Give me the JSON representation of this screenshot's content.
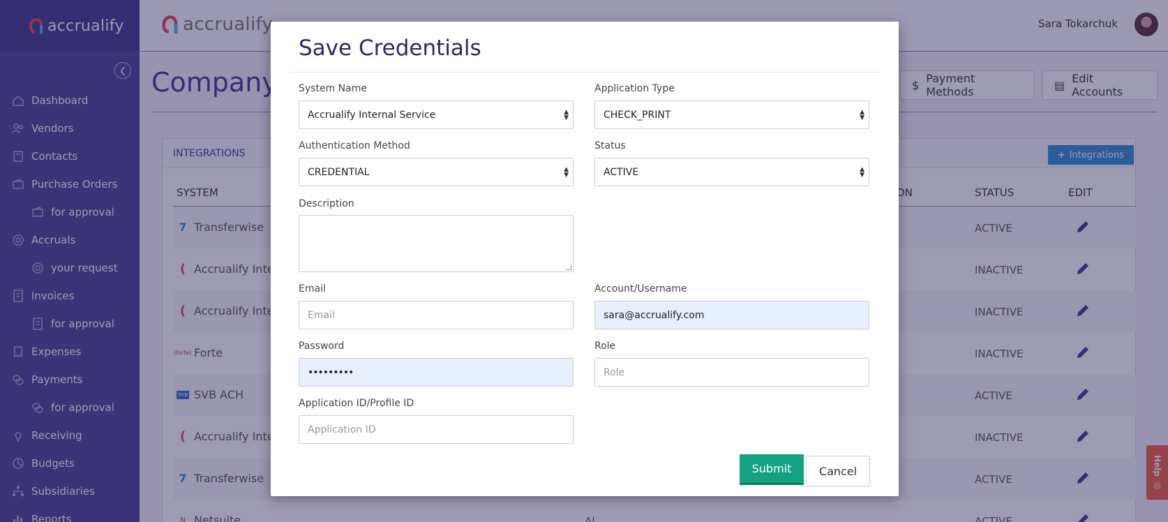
{
  "brand": {
    "name": "accrualify"
  },
  "sidebar": {
    "items": [
      {
        "label": "Dashboard",
        "icon": "home-icon",
        "sub": false
      },
      {
        "label": "Vendors",
        "icon": "users-icon",
        "sub": false
      },
      {
        "label": "Contacts",
        "icon": "contact-book-icon",
        "sub": false
      },
      {
        "label": "Purchase Orders",
        "icon": "wallet-icon",
        "sub": false
      },
      {
        "label": "for approval",
        "icon": "wallet-icon",
        "sub": true
      },
      {
        "label": "Accruals",
        "icon": "target-icon",
        "sub": false
      },
      {
        "label": "your request",
        "icon": "target-icon",
        "sub": true
      },
      {
        "label": "Invoices",
        "icon": "document-icon",
        "sub": false
      },
      {
        "label": "for approval",
        "icon": "document-icon",
        "sub": true
      },
      {
        "label": "Expenses",
        "icon": "receipt-icon",
        "sub": false
      },
      {
        "label": "Payments",
        "icon": "coins-icon",
        "sub": false
      },
      {
        "label": "for approval",
        "icon": "coins-icon",
        "sub": true
      },
      {
        "label": "Receiving",
        "icon": "pin-icon",
        "sub": false
      },
      {
        "label": "Budgets",
        "icon": "pie-icon",
        "sub": false
      },
      {
        "label": "Subsidiaries",
        "icon": "hierarchy-icon",
        "sub": false
      },
      {
        "label": "Reports",
        "icon": "bar-chart-icon",
        "sub": false
      }
    ]
  },
  "topbar": {
    "user_name": "Sara Tokarchuk"
  },
  "page": {
    "title": "Company",
    "payment_methods_label": "Payment Methods",
    "edit_accounts_label": "Edit Accounts"
  },
  "integrations": {
    "header": "INTEGRATIONS",
    "add_button": "Integrations",
    "columns": {
      "system": "SYSTEM",
      "auth_partial": "ON",
      "status": "STATUS",
      "edit": "EDIT"
    },
    "rows": [
      {
        "system": "Transferwise",
        "status": "ACTIVE",
        "icon": "transferwise-icon"
      },
      {
        "system": "Accrualify Integ",
        "status": "INACTIVE",
        "icon": "accrualify-icon"
      },
      {
        "system": "Accrualify Integ",
        "status": "INACTIVE",
        "icon": "accrualify-icon"
      },
      {
        "system": "Forte",
        "status": "INACTIVE",
        "icon": "forte-icon"
      },
      {
        "system": "SVB ACH",
        "status": "ACTIVE",
        "icon": "svb-icon"
      },
      {
        "system": "Accrualify Integ",
        "status": "INACTIVE",
        "icon": "accrualify-icon"
      },
      {
        "system": "Transferwise",
        "status": "ACTIVE",
        "icon": "transferwise-icon"
      },
      {
        "system": "Netsuite",
        "status": "ACTIVE",
        "icon": "netsuite-icon",
        "extra": "Al"
      }
    ]
  },
  "help_label": "Help",
  "modal": {
    "title": "Save Credentials",
    "system_name": {
      "label": "System Name",
      "value": "Accrualify Internal Service"
    },
    "application_type": {
      "label": "Application Type",
      "value": "CHECK_PRINT"
    },
    "auth_method": {
      "label": "Authentication Method",
      "value": "CREDENTIAL"
    },
    "status": {
      "label": "Status",
      "value": "ACTIVE"
    },
    "description": {
      "label": "Description",
      "value": ""
    },
    "email": {
      "label": "Email",
      "placeholder": "Email",
      "value": ""
    },
    "account": {
      "label": "Account/Username",
      "value": "sara@accrualify.com"
    },
    "password": {
      "label": "Password",
      "value": "•••••••••"
    },
    "role": {
      "label": "Role",
      "placeholder": "Role",
      "value": ""
    },
    "app_id": {
      "label": "Application ID/Profile ID",
      "placeholder": "Application ID",
      "value": ""
    },
    "submit_label": "Submit",
    "cancel_label": "Cancel"
  },
  "colors": {
    "sidebar_bg": "#4a4290",
    "accent_purple": "#3d3788",
    "submit_green": "#15a283",
    "integrations_blue": "#2f8bcc",
    "help_orange": "#ee5d3c",
    "autofill_blue": "#e8f0fd"
  }
}
